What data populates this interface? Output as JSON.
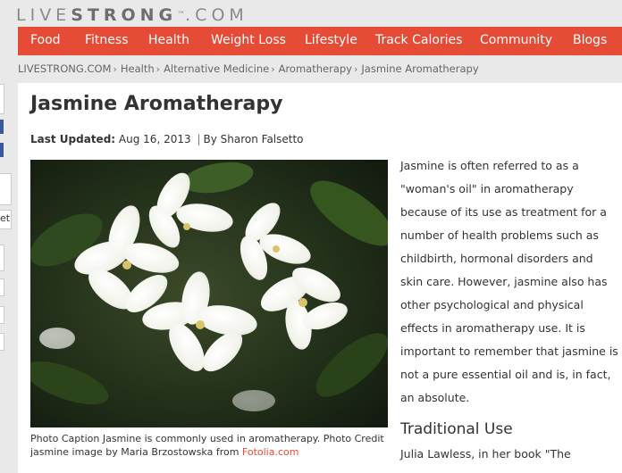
{
  "site": {
    "logo_light": "LIVE",
    "logo_bold": "STRONG",
    "logo_tm": "™",
    "logo_suffix": ".COM"
  },
  "nav": {
    "items": [
      "Food",
      "Fitness",
      "Health",
      "Weight Loss",
      "Lifestyle",
      "Track Calories",
      "Community",
      "Blogs"
    ]
  },
  "breadcrumb": {
    "items": [
      "LIVESTRONG.COM",
      "Health",
      "Alternative Medicine",
      "Aromatherapy",
      "Jasmine Aromatherapy"
    ]
  },
  "sidebar_stub": {
    "button_fragment": "et"
  },
  "article": {
    "title": "Jasmine Aromatherapy",
    "updated_label": "Last Updated:",
    "updated_date": "Aug 16, 2013",
    "byline_sep": "|",
    "author": "By Sharon Falsetto",
    "caption_text": "Photo Caption Jasmine is commonly used in aromatherapy. Photo Credit jasmine image by Maria Brzostowska from ",
    "caption_credit": "Fotolia.com",
    "paragraph_lines": [
      "Jasmine is often referred to as a",
      "\"woman's oil\" in aromatherapy",
      "because of its use as treatment for a",
      "number of health problems such as",
      "childbirth, hormonal disorders and",
      "skin care. However, jasmine also has",
      "other psychological and physical",
      "effects in aromatherapy use. It is",
      "important to remember that jasmine is",
      "not a pure essential oil and is, in fact,",
      "an absolute."
    ],
    "subhead": "Traditional Use",
    "paragraph2_start": "Julia Lawless, in her book \"The"
  },
  "colors": {
    "nav_bg": "#e64b36",
    "link": "#e64b36",
    "page_bg": "#e9e9e9"
  }
}
